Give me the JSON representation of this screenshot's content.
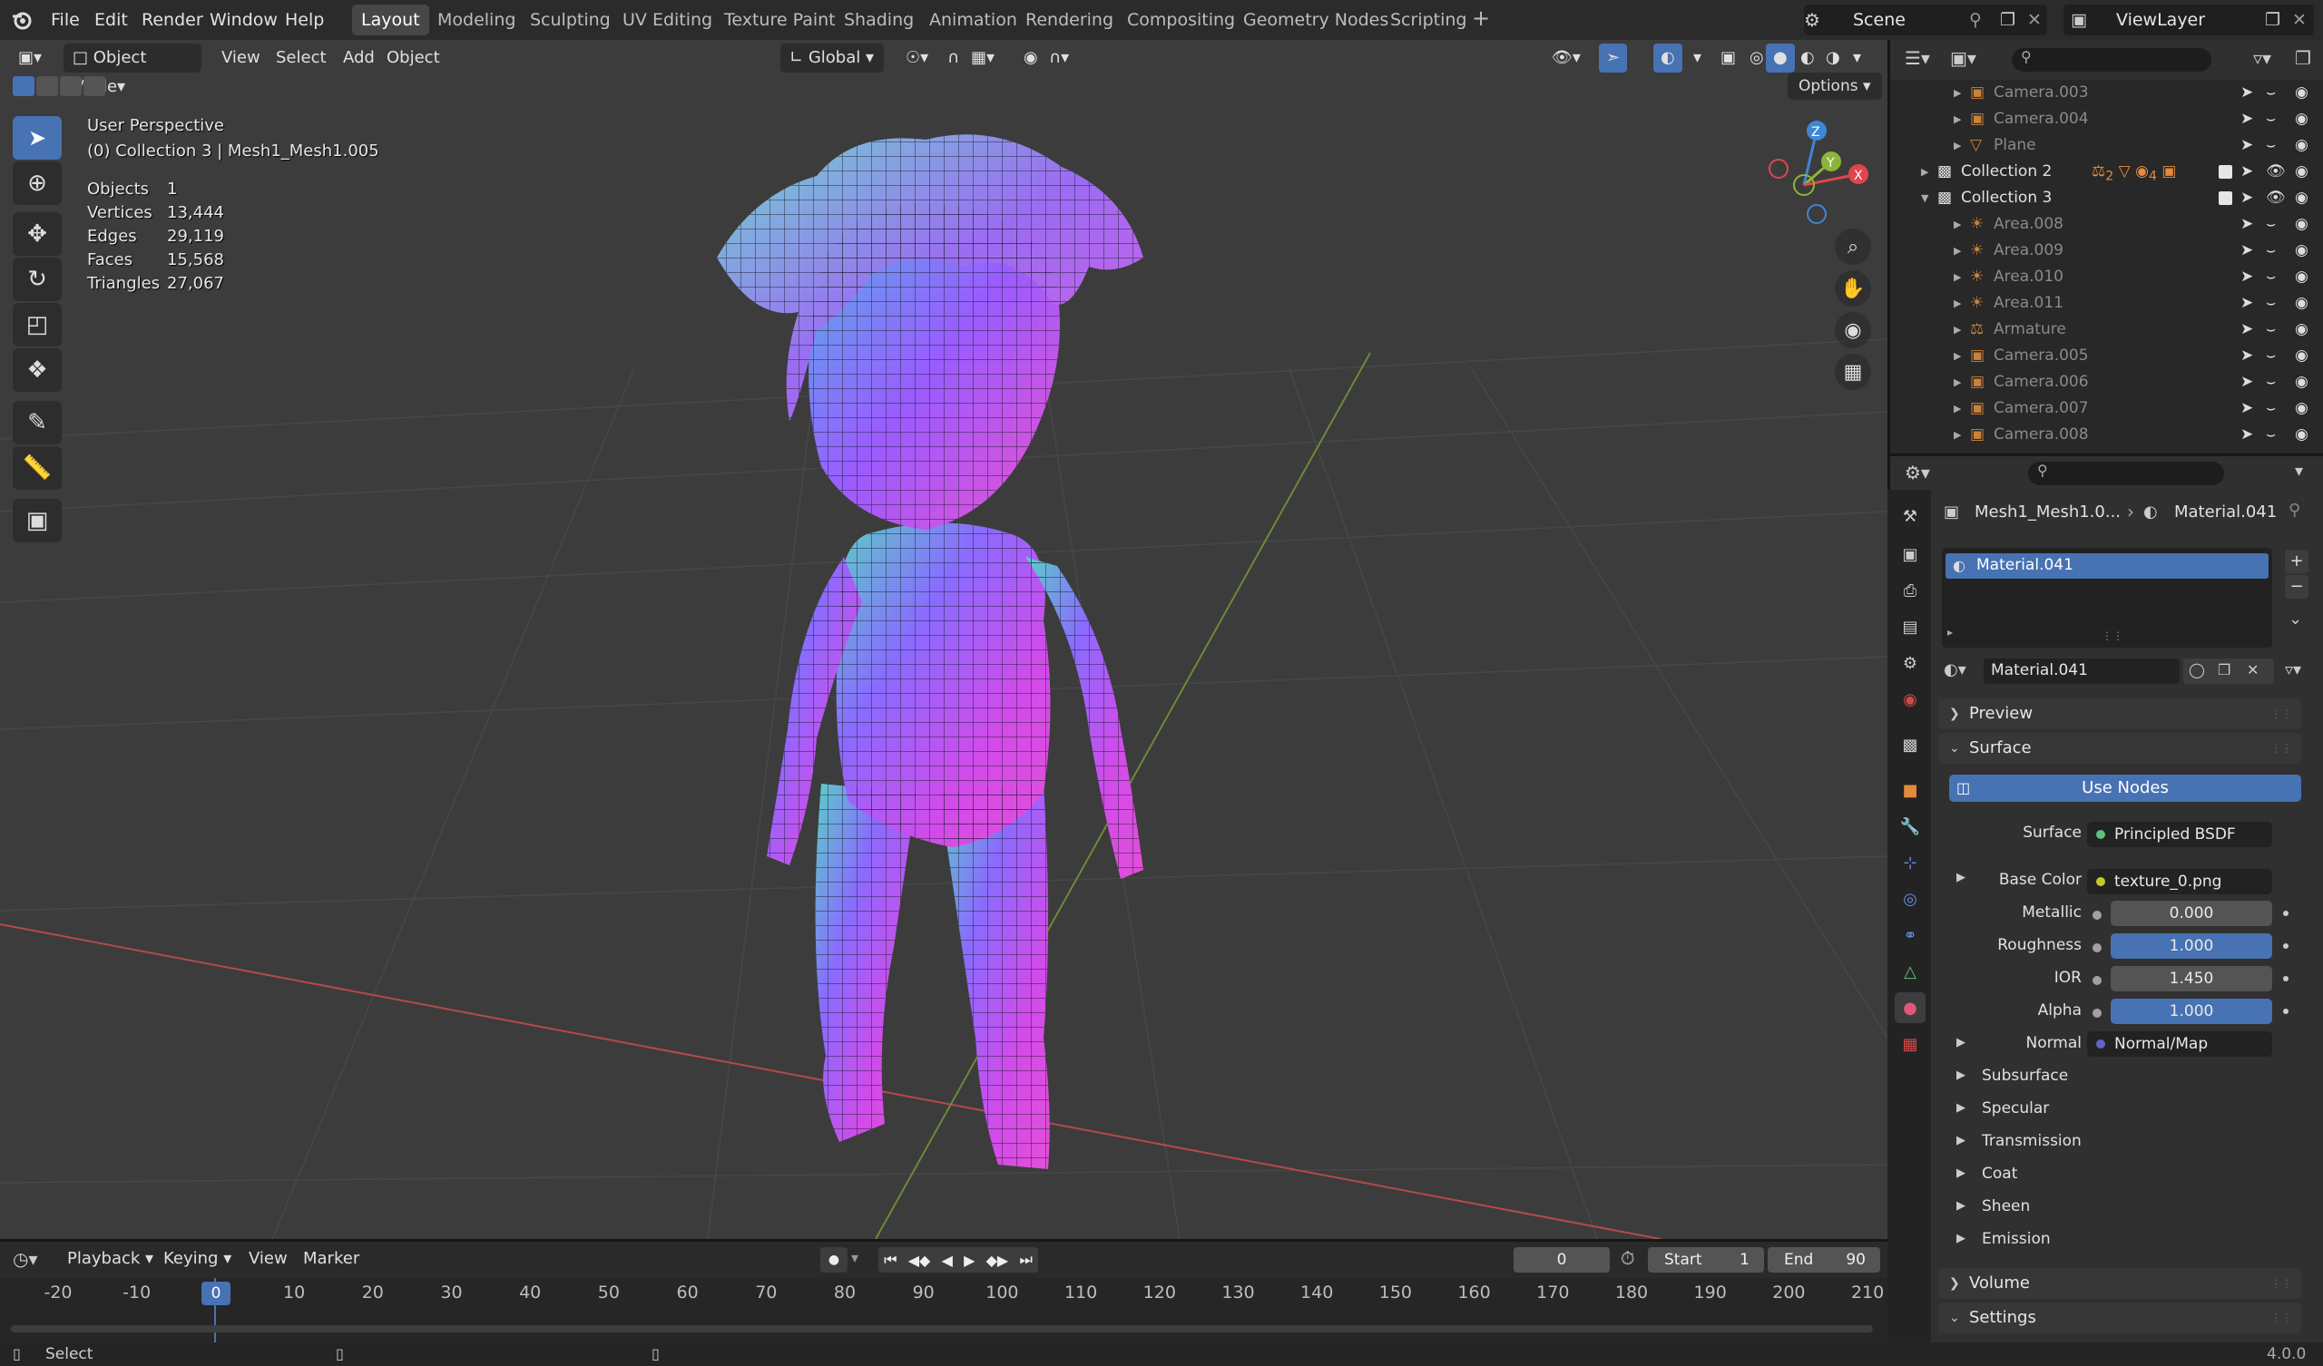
{
  "topbar": {
    "menus": [
      "File",
      "Edit",
      "Render",
      "Window",
      "Help"
    ],
    "workspaces": [
      "Layout",
      "Modeling",
      "Sculpting",
      "UV Editing",
      "Texture Paint",
      "Shading",
      "Animation",
      "Rendering",
      "Compositing",
      "Geometry Nodes",
      "Scripting"
    ],
    "active_workspace": "Layout",
    "scene": "Scene",
    "view_layer": "ViewLayer"
  },
  "viewport_header": {
    "mode": "Object Mode",
    "menus": [
      "View",
      "Select",
      "Add",
      "Object"
    ],
    "orientation": "Global",
    "options_label": "Options"
  },
  "overlay": {
    "view_name": "User Perspective",
    "context": "(0) Collection 3 | Mesh1_Mesh1.005",
    "stats": [
      {
        "label": "Objects",
        "value": "1"
      },
      {
        "label": "Vertices",
        "value": "13,444"
      },
      {
        "label": "Edges",
        "value": "29,119"
      },
      {
        "label": "Faces",
        "value": "15,568"
      },
      {
        "label": "Triangles",
        "value": "27,067"
      }
    ]
  },
  "gizmo": {
    "z": "Z",
    "y": "Y",
    "x": "X"
  },
  "outliner": {
    "rows": [
      {
        "name": "Camera.003",
        "type": "camera"
      },
      {
        "name": "Camera.004",
        "type": "camera"
      },
      {
        "name": "Plane",
        "type": "mesh"
      },
      {
        "name": "Collection 2",
        "type": "collection"
      },
      {
        "name": "Collection 3",
        "type": "collection"
      },
      {
        "name": "Area.008",
        "type": "light"
      },
      {
        "name": "Area.009",
        "type": "light"
      },
      {
        "name": "Area.010",
        "type": "light"
      },
      {
        "name": "Area.011",
        "type": "light"
      },
      {
        "name": "Armature",
        "type": "armature"
      },
      {
        "name": "Camera.005",
        "type": "camera"
      },
      {
        "name": "Camera.006",
        "type": "camera"
      },
      {
        "name": "Camera.007",
        "type": "camera"
      },
      {
        "name": "Camera.008",
        "type": "camera"
      },
      {
        "name": "Mesh1_Mesh1.005",
        "type": "mesh"
      }
    ],
    "collection2_badges": [
      "2",
      "4"
    ]
  },
  "properties": {
    "breadcrumb_object": "Mesh1_Mesh1.0...",
    "breadcrumb_material": "Material.041",
    "slot_name": "Material.041",
    "material_name": "Material.041",
    "panels": {
      "preview": "Preview",
      "surface": "Surface",
      "volume": "Volume",
      "settings": "Settings"
    },
    "use_nodes": "Use Nodes",
    "surface_label": "Surface",
    "surface_value": "Principled BSDF",
    "base_color_label": "Base Color",
    "base_color_value": "texture_0.png",
    "metallic_label": "Metallic",
    "metallic_value": "0.000",
    "roughness_label": "Roughness",
    "roughness_value": "1.000",
    "ior_label": "IOR",
    "ior_value": "1.450",
    "alpha_label": "Alpha",
    "alpha_value": "1.000",
    "normal_label": "Normal",
    "normal_value": "Normal/Map",
    "subpanels": [
      "Subsurface",
      "Specular",
      "Transmission",
      "Coat",
      "Sheen",
      "Emission"
    ]
  },
  "timeline": {
    "menus": [
      "Playback",
      "Keying",
      "View",
      "Marker"
    ],
    "current_frame": "0",
    "start_label": "Start",
    "start_value": "1",
    "end_label": "End",
    "end_value": "90",
    "ticks": [
      "-20",
      "-10",
      "0",
      "10",
      "20",
      "30",
      "40",
      "50",
      "60",
      "70",
      "80",
      "90",
      "100",
      "110",
      "120",
      "130",
      "140",
      "150",
      "160",
      "170",
      "180",
      "190",
      "200",
      "210"
    ],
    "playhead": "0"
  },
  "statusbar": {
    "left": "Select",
    "version": "4.0.0"
  },
  "colors": {
    "accent": "#4772b3",
    "x_axis": "#e0454f",
    "y_axis": "#8cb537",
    "z_axis": "#3f86d6"
  }
}
